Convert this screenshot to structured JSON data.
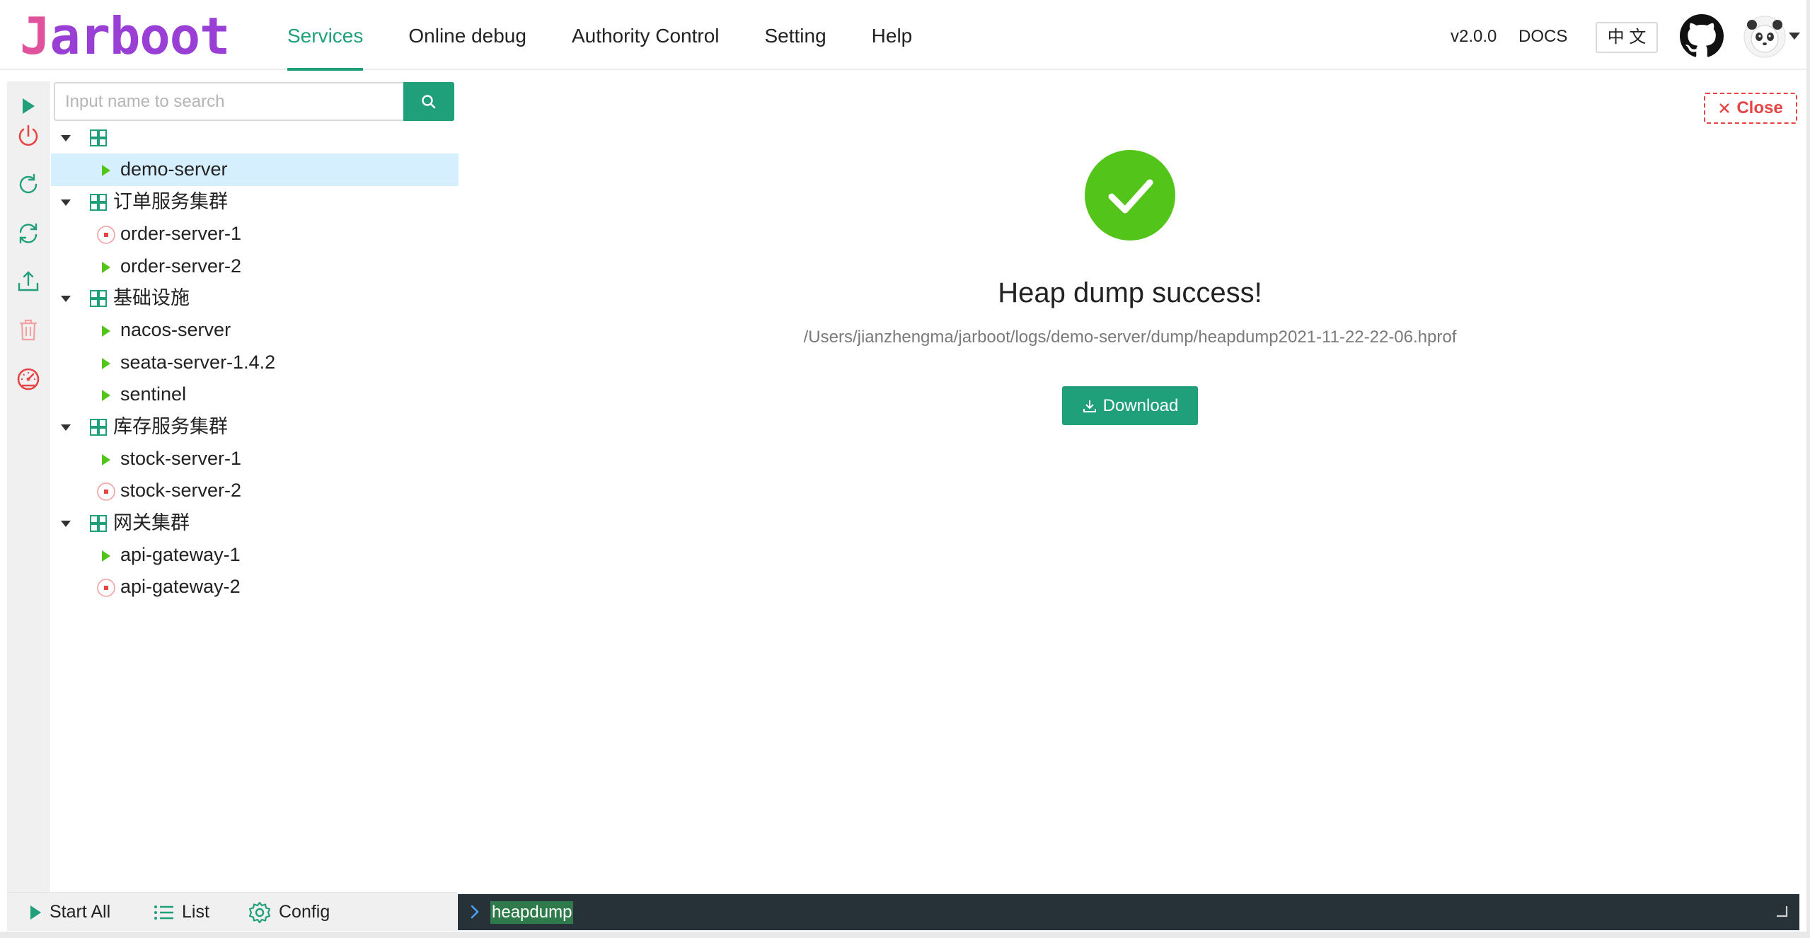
{
  "header": {
    "logo": "Jarboot",
    "nav": [
      "Services",
      "Online debug",
      "Authority Control",
      "Setting",
      "Help"
    ],
    "version": "v2.0.0",
    "docs": "DOCS",
    "language": "中 文"
  },
  "search": {
    "placeholder": "Input name to search",
    "value": ""
  },
  "tree": {
    "groups": [
      {
        "label": "",
        "services": [
          {
            "name": "demo-server",
            "status": "running",
            "selected": true
          }
        ]
      },
      {
        "label": "订单服务集群",
        "services": [
          {
            "name": "order-server-1",
            "status": "stopped"
          },
          {
            "name": "order-server-2",
            "status": "running"
          }
        ]
      },
      {
        "label": "基础设施",
        "services": [
          {
            "name": "nacos-server",
            "status": "running"
          },
          {
            "name": "seata-server-1.4.2",
            "status": "running"
          },
          {
            "name": "sentinel",
            "status": "running"
          }
        ]
      },
      {
        "label": "库存服务集群",
        "services": [
          {
            "name": "stock-server-1",
            "status": "running"
          },
          {
            "name": "stock-server-2",
            "status": "stopped"
          }
        ]
      },
      {
        "label": "网关集群",
        "services": [
          {
            "name": "api-gateway-1",
            "status": "running"
          },
          {
            "name": "api-gateway-2",
            "status": "stopped"
          }
        ]
      }
    ]
  },
  "toolbar_icons": [
    "play-icon",
    "power-icon",
    "restart-icon",
    "sync-icon",
    "upload-icon",
    "delete-icon",
    "dashboard-icon"
  ],
  "bottom": {
    "start_all": "Start All",
    "list": "List",
    "config": "Config"
  },
  "command": {
    "text": "heapdump"
  },
  "result": {
    "close": "Close",
    "title": "Heap dump success!",
    "path": "/Users/jianzhengma/jarboot/logs/demo-server/dump/heapdump2021-11-22-22-06.hprof",
    "download": "Download"
  },
  "colors": {
    "primary": "#1fa07a",
    "success": "#52c41a",
    "running": "#52c41a",
    "stopped": "#e54545",
    "selected_row": "#d6efff",
    "command_bar": "#263238"
  }
}
